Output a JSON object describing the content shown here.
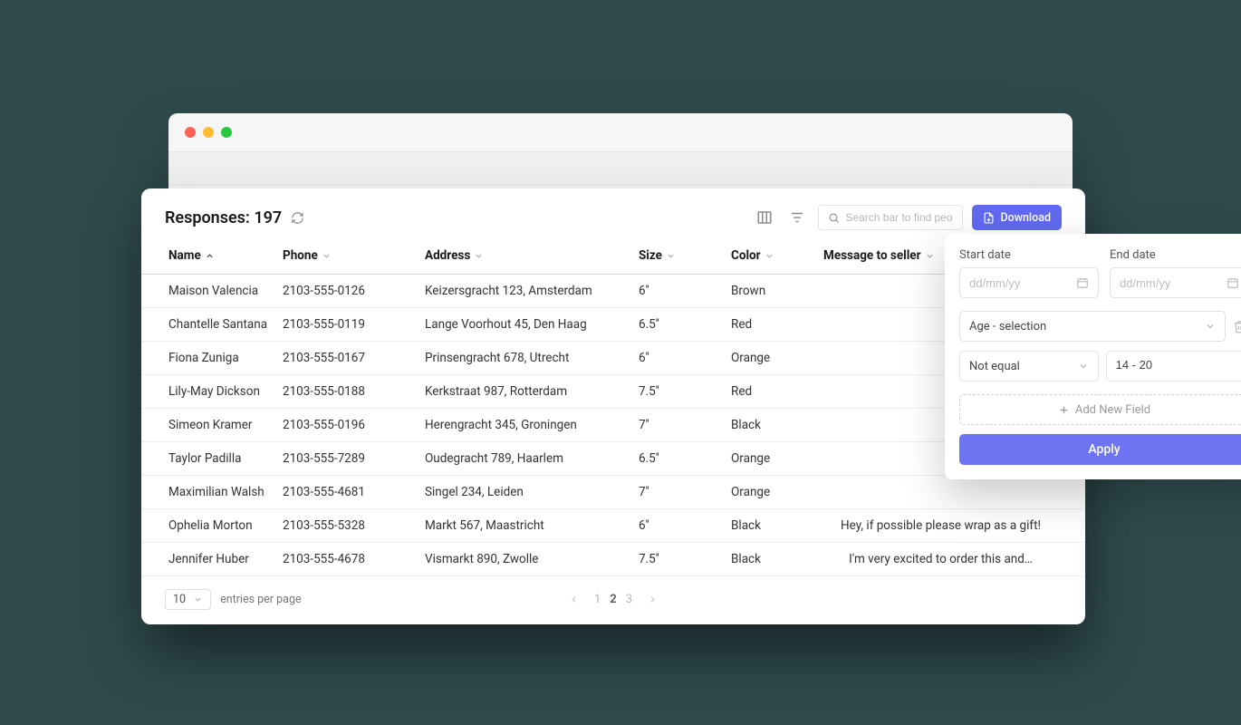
{
  "header": {
    "title_prefix": "Responses:",
    "count": "197",
    "search_placeholder": "Search bar to find people",
    "download_label": "Download"
  },
  "columns": {
    "name": "Name",
    "phone": "Phone",
    "address": "Address",
    "size": "Size",
    "color": "Color",
    "message": "Message to seller"
  },
  "rows": [
    {
      "name": "Maison Valencia",
      "phone": "2103-555-0126",
      "address": "Keizersgracht 123, Amsterdam",
      "size": "6''",
      "color": "Brown",
      "msg": ""
    },
    {
      "name": "Chantelle Santana",
      "phone": "2103-555-0119",
      "address": "Lange Voorhout 45, Den Haag",
      "size": "6.5''",
      "color": "Red",
      "msg": ""
    },
    {
      "name": "Fiona Zuniga",
      "phone": "2103-555-0167",
      "address": "Prinsengracht 678, Utrecht",
      "size": "6''",
      "color": "Orange",
      "msg": ""
    },
    {
      "name": "Lily-May Dickson",
      "phone": "2103-555-0188",
      "address": "Kerkstraat 987, Rotterdam",
      "size": "7.5''",
      "color": "Red",
      "msg": ""
    },
    {
      "name": "Simeon Kramer",
      "phone": "2103-555-0196",
      "address": "Herengracht 345, Groningen",
      "size": "7''",
      "color": "Black",
      "msg": ""
    },
    {
      "name": "Taylor Padilla",
      "phone": "2103-555-7289",
      "address": "Oudegracht 789, Haarlem",
      "size": "6.5''",
      "color": "Orange",
      "msg": ""
    },
    {
      "name": "Maximilian Walsh",
      "phone": "2103-555-4681",
      "address": "Singel 234, Leiden",
      "size": "7''",
      "color": "Orange",
      "msg": ""
    },
    {
      "name": "Ophelia Morton",
      "phone": "2103-555-5328",
      "address": "Markt 567, Maastricht",
      "size": "6''",
      "color": "Black",
      "msg": "Hey, if possible please wrap as a gift!"
    },
    {
      "name": "Jennifer Huber",
      "phone": "2103-555-4678",
      "address": "Vismarkt 890, Zwolle",
      "size": "7.5''",
      "color": "Black",
      "msg": "I'm very excited to order this and…"
    }
  ],
  "footer": {
    "entries_value": "10",
    "entries_label": "entries per page",
    "pages": [
      "1",
      "2",
      "3"
    ],
    "active_page": "2"
  },
  "filter": {
    "start_label": "Start date",
    "end_label": "End date",
    "date_placeholder": "dd/mm/yy",
    "field_select": "Age - selection",
    "condition": "Not equal",
    "value": "14 - 20",
    "add_label": "Add New Field",
    "apply_label": "Apply"
  }
}
